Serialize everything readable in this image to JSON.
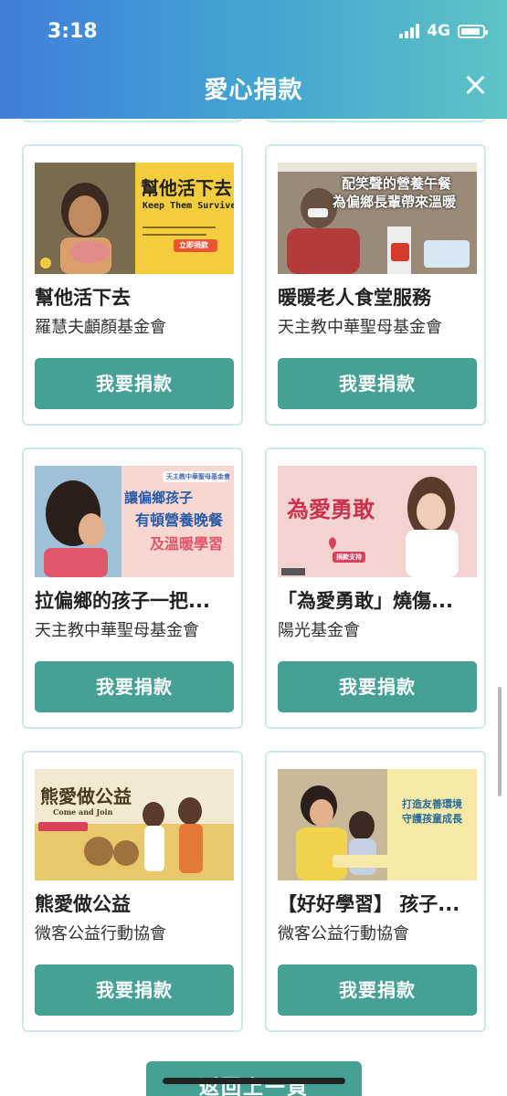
{
  "status_bar": {
    "time": "3:18",
    "network": "4G"
  },
  "header": {
    "title": "愛心捐款"
  },
  "cards": [
    {
      "title": "幫他活下去",
      "org": "羅慧夫顱顏基金會",
      "button": "我要捐款",
      "poster": {
        "headline": "幫他活下去",
        "subtitle": "Keep Them Survive",
        "cta": "立即捐款"
      }
    },
    {
      "title": "暖暖老人食堂服務",
      "org": "天主教中華聖母基金會",
      "button": "我要捐款",
      "poster": {
        "line1": "配笑聲的營養午餐",
        "line2": "為偏鄉長輩帶來溫暖"
      }
    },
    {
      "title": "拉偏鄉的孩子一把...",
      "org": "天主教中華聖母基金會",
      "button": "我要捐款",
      "poster": {
        "badge": "天主教中華聖母基金會",
        "line1": "讓偏鄉孩子",
        "line2": "有頓營養晚餐",
        "line3": "及溫暖學習"
      }
    },
    {
      "title": "「為愛勇敢」燒傷...",
      "org": "陽光基金會",
      "button": "我要捐款",
      "poster": {
        "headline": "為愛勇敢",
        "cta": "捐款支持"
      }
    },
    {
      "title": "熊愛做公益",
      "org": "微客公益行動協會",
      "button": "我要捐款",
      "poster": {
        "headline": "熊愛做公益",
        "subtitle": "Come and Join"
      }
    },
    {
      "title": "【好好學習】 孩子...",
      "org": "微客公益行動協會",
      "button": "我要捐款",
      "poster": {
        "line1": "打造友善環境",
        "line2": "守護孩童成長"
      }
    }
  ],
  "footer": {
    "back_button": "返回上一頁"
  },
  "colors": {
    "header_start": "#3f7fdc",
    "header_end": "#5cc3c6",
    "button": "#46a195",
    "card_border": "#cfe8ec"
  }
}
